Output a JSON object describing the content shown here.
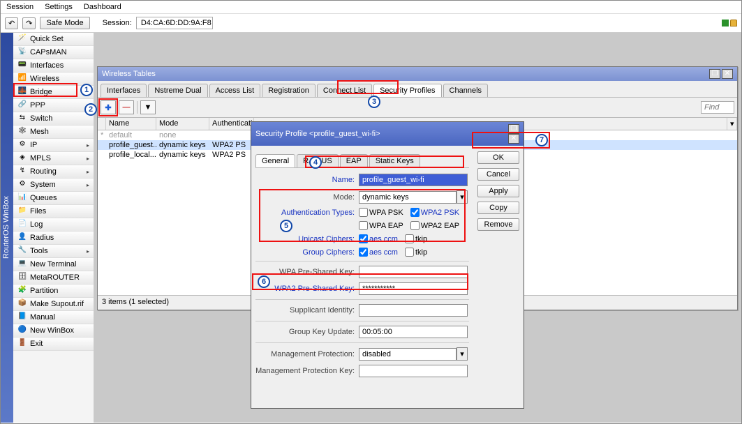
{
  "menu": {
    "session": "Session",
    "settings": "Settings",
    "dashboard": "Dashboard"
  },
  "toolbar": {
    "undo": "↶",
    "redo": "↷",
    "safe_mode": "Safe Mode",
    "session_lbl": "Session:",
    "session_val": "D4:CA:6D:DD:9A:F8"
  },
  "vtab": "RouterOS WinBox",
  "sidebar": {
    "items": [
      {
        "icon": "🪄",
        "label": "Quick Set",
        "arrow": false
      },
      {
        "icon": "📡",
        "label": "CAPsMAN",
        "arrow": false
      },
      {
        "icon": "📟",
        "label": "Interfaces",
        "arrow": false
      },
      {
        "icon": "📶",
        "label": "Wireless",
        "arrow": false,
        "hl": true
      },
      {
        "icon": "🌉",
        "label": "Bridge",
        "arrow": false
      },
      {
        "icon": "🔗",
        "label": "PPP",
        "arrow": false
      },
      {
        "icon": "⇆",
        "label": "Switch",
        "arrow": false
      },
      {
        "icon": "🕸",
        "label": "Mesh",
        "arrow": false
      },
      {
        "icon": "⚙",
        "label": "IP",
        "arrow": true
      },
      {
        "icon": "◈",
        "label": "MPLS",
        "arrow": true
      },
      {
        "icon": "↯",
        "label": "Routing",
        "arrow": true
      },
      {
        "icon": "⚙",
        "label": "System",
        "arrow": true
      },
      {
        "icon": "📊",
        "label": "Queues",
        "arrow": false
      },
      {
        "icon": "📁",
        "label": "Files",
        "arrow": false
      },
      {
        "icon": "📄",
        "label": "Log",
        "arrow": false
      },
      {
        "icon": "👤",
        "label": "Radius",
        "arrow": false
      },
      {
        "icon": "🔧",
        "label": "Tools",
        "arrow": true
      },
      {
        "icon": "💻",
        "label": "New Terminal",
        "arrow": false
      },
      {
        "icon": "🗄",
        "label": "MetaROUTER",
        "arrow": false
      },
      {
        "icon": "🧩",
        "label": "Partition",
        "arrow": false
      },
      {
        "icon": "📦",
        "label": "Make Supout.rif",
        "arrow": false
      },
      {
        "icon": "📘",
        "label": "Manual",
        "arrow": false
      },
      {
        "icon": "🔵",
        "label": "New WinBox",
        "arrow": false
      },
      {
        "icon": "🚪",
        "label": "Exit",
        "arrow": false
      }
    ]
  },
  "wt": {
    "title": "Wireless Tables",
    "tabs": [
      "Interfaces",
      "Nstreme Dual",
      "Access List",
      "Registration",
      "Connect List",
      "Security Profiles",
      "Channels"
    ],
    "active_tab": 5,
    "add": "✚",
    "remove": "—",
    "filter": "▿",
    "find": "Find",
    "cols": [
      "Name",
      "Mode",
      "Authenticati..."
    ],
    "rows": [
      {
        "marker": "*",
        "name": "default",
        "mode": "none",
        "auth": "",
        "style": "def"
      },
      {
        "marker": "",
        "name": "profile_guest...",
        "mode": "dynamic keys",
        "auth": "WPA2 PS",
        "style": "sel"
      },
      {
        "marker": "",
        "name": "profile_local...",
        "mode": "dynamic keys",
        "auth": "WPA2 PS",
        "style": ""
      }
    ],
    "status": "3 items (1 selected)"
  },
  "dlg": {
    "title": "Security Profile <profile_guest_wi-fi>",
    "tabs": [
      "General",
      "RADIUS",
      "EAP",
      "Static Keys"
    ],
    "active_tab": 0,
    "btns": {
      "ok": "OK",
      "cancel": "Cancel",
      "apply": "Apply",
      "copy": "Copy",
      "remove": "Remove"
    },
    "fields": {
      "name_lbl": "Name:",
      "name_val": "profile_guest_wi-fi",
      "mode_lbl": "Mode:",
      "mode_val": "dynamic keys",
      "auth_lbl": "Authentication Types:",
      "wpa_psk": "WPA PSK",
      "wpa2_psk": "WPA2 PSK",
      "wpa_eap": "WPA EAP",
      "wpa2_eap": "WPA2 EAP",
      "uc_lbl": "Unicast Ciphers:",
      "aes": "aes ccm",
      "tkip": "tkip",
      "gc_lbl": "Group Ciphers:",
      "wpa_key_lbl": "WPA Pre-Shared Key:",
      "wpa2_key_lbl": "WPA2 Pre-Shared Key:",
      "wpa2_key_val": "***********",
      "supp_lbl": "Supplicant Identity:",
      "gku_lbl": "Group Key Update:",
      "gku_val": "00:05:00",
      "mp_lbl": "Management Protection:",
      "mp_val": "disabled",
      "mpk_lbl": "Management Protection Key:"
    }
  },
  "badges": [
    "1",
    "2",
    "3",
    "4",
    "5",
    "6",
    "7"
  ]
}
